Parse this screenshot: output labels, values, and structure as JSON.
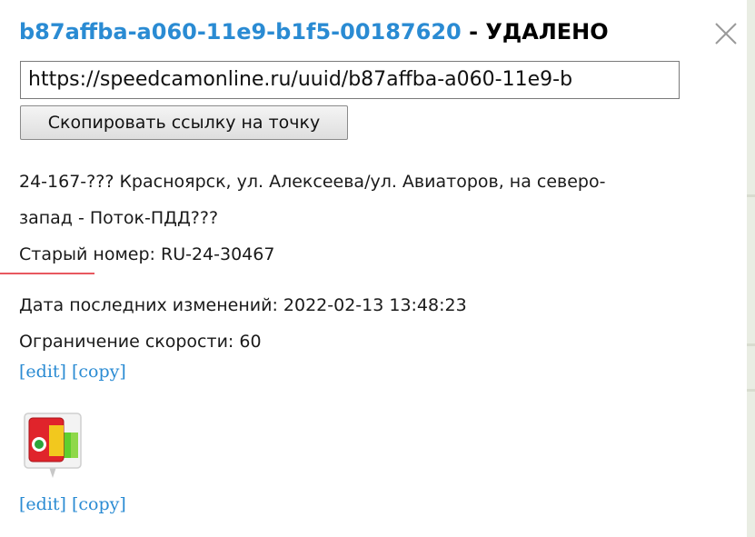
{
  "popup": {
    "title_uuid": "b87affba-a060-11e9-b1f5-00187620",
    "title_status": "- УДАЛЕНО",
    "url_value": "https://speedcamonline.ru/uuid/b87affba-a060-11e9-b",
    "copy_link_label": "Скопировать ссылку на точку",
    "description_line1": "24-167-??? Красноярск, ул. Алексеева/ул. Авиаторов, на северо-",
    "description_line2": "запад - Поток-ПДД???",
    "old_number": "Старый номер: RU-24-30467",
    "last_modified": "Дата последних изменений: 2022-02-13 13:48:23",
    "speed_limit": "Ограничение скорости: 60",
    "links_top": {
      "edit": "[edit]",
      "copy": "[copy]"
    },
    "links_bottom": {
      "edit": "[edit]",
      "copy": "[copy]"
    },
    "icons": {
      "close": "close-icon",
      "camera": "traffic-light-camera-icon"
    },
    "colors": {
      "link": "#2a8bd3",
      "accent_underline": "#e8585f",
      "icon_red": "#e0242b",
      "icon_yellow": "#f2c81e",
      "icon_green": "#5fcf2e"
    }
  }
}
